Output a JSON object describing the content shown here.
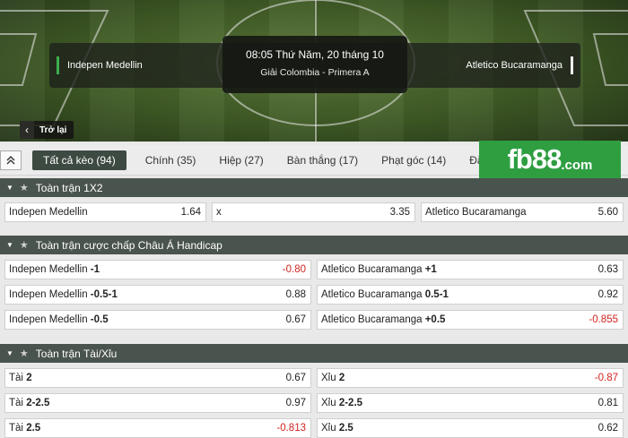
{
  "match": {
    "home": "Indepen Medellin",
    "away": "Atletico Bucaramanga",
    "datetime": "08:05 Thứ Năm, 20 tháng 10",
    "league": "Giải Colombia - Primera A",
    "back_label": "Trở lại"
  },
  "tabs": [
    {
      "label": "Tất cả kèo (94)",
      "active": true
    },
    {
      "label": "Chính (35)",
      "active": false
    },
    {
      "label": "Hiệp (27)",
      "active": false
    },
    {
      "label": "Bàn thắng (17)",
      "active": false
    },
    {
      "label": "Phạt góc (14)",
      "active": false
    },
    {
      "label": "Đặc biệ",
      "active": false
    }
  ],
  "brand": {
    "main": "fb88",
    "suffix": ".com",
    "color": "#2e9e41"
  },
  "colors": {
    "section_header": "#4a544e",
    "negative_odd": "#d0231f",
    "tab_active": "#3d4a42"
  },
  "sections": [
    {
      "title": "Toàn trận 1X2",
      "rows": [
        [
          {
            "name": "Indepen Medellin",
            "line": "",
            "odd": "1.64",
            "neg": false
          },
          {
            "name": "x",
            "line": "",
            "odd": "3.35",
            "neg": false
          },
          {
            "name": "Atletico Bucaramanga",
            "line": "",
            "odd": "5.60",
            "neg": false
          }
        ]
      ]
    },
    {
      "title": "Toàn trận cược chấp Châu Á Handicap",
      "rows": [
        [
          {
            "name": "Indepen Medellin",
            "line": "-1",
            "odd": "-0.80",
            "neg": true
          },
          {
            "name": "Atletico Bucaramanga",
            "line": "+1",
            "odd": "0.63",
            "neg": false
          }
        ],
        [
          {
            "name": "Indepen Medellin",
            "line": "-0.5-1",
            "odd": "0.88",
            "neg": false
          },
          {
            "name": "Atletico Bucaramanga",
            "line": "0.5-1",
            "odd": "0.92",
            "neg": false
          }
        ],
        [
          {
            "name": "Indepen Medellin",
            "line": "-0.5",
            "odd": "0.67",
            "neg": false
          },
          {
            "name": "Atletico Bucaramanga",
            "line": "+0.5",
            "odd": "-0.855",
            "neg": true
          }
        ]
      ]
    },
    {
      "title": "Toàn trận Tài/Xỉu",
      "rows": [
        [
          {
            "name": "Tài",
            "line": "2",
            "odd": "0.67",
            "neg": false
          },
          {
            "name": "Xỉu",
            "line": "2",
            "odd": "-0.87",
            "neg": true
          }
        ],
        [
          {
            "name": "Tài",
            "line": "2-2.5",
            "odd": "0.97",
            "neg": false
          },
          {
            "name": "Xỉu",
            "line": "2-2.5",
            "odd": "0.81",
            "neg": false
          }
        ],
        [
          {
            "name": "Tài",
            "line": "2.5",
            "odd": "-0.813",
            "neg": true
          },
          {
            "name": "Xỉu",
            "line": "2.5",
            "odd": "0.62",
            "neg": false
          }
        ]
      ]
    }
  ]
}
